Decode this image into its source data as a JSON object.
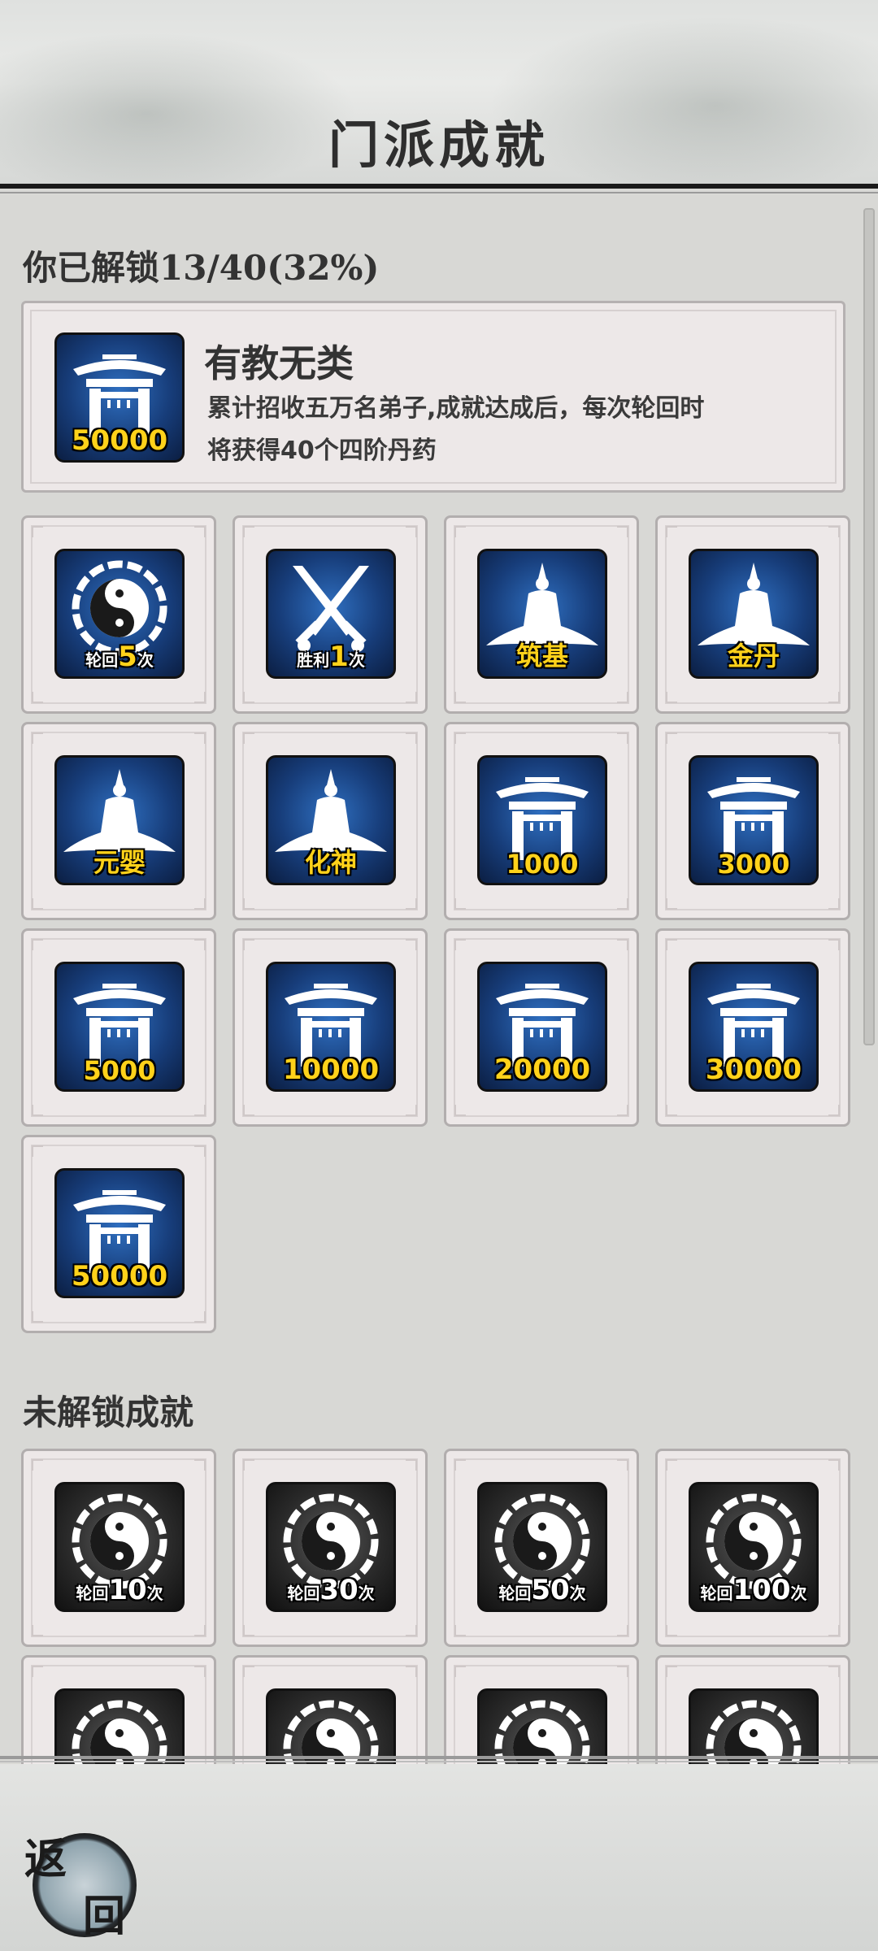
{
  "header": {
    "title": "门派成就"
  },
  "unlocked": {
    "heading": "你已解锁13/40(32%)",
    "featured": {
      "icon": "gate-icon",
      "icon_label": "50000",
      "name": "有教无类",
      "desc_line1": "累计招收五万名弟子,成就达成后，每次轮回时",
      "desc_line2": "将获得40个四阶丹药"
    },
    "tiles": [
      {
        "icon": "yin-yang-icon",
        "pre": "轮回",
        "num": "5",
        "post": "次"
      },
      {
        "icon": "crossed-swords-icon",
        "pre": "胜利",
        "num": "1",
        "post": "次"
      },
      {
        "icon": "cultivator-icon",
        "label": "筑基"
      },
      {
        "icon": "cultivator-icon",
        "label": "金丹"
      },
      {
        "icon": "cultivator-icon",
        "label": "元婴"
      },
      {
        "icon": "cultivator-icon",
        "label": "化神"
      },
      {
        "icon": "gate-icon",
        "label": "1000"
      },
      {
        "icon": "gate-icon",
        "label": "3000"
      },
      {
        "icon": "gate-icon",
        "label": "5000"
      },
      {
        "icon": "gate-icon",
        "label": "10000"
      },
      {
        "icon": "gate-icon",
        "label": "20000"
      },
      {
        "icon": "gate-icon",
        "label": "30000"
      },
      {
        "icon": "gate-icon",
        "label": "50000"
      }
    ]
  },
  "locked": {
    "heading": "未解锁成就",
    "tiles": [
      {
        "icon": "yin-yang-icon",
        "pre": "轮回",
        "num": "10",
        "post": "次"
      },
      {
        "icon": "yin-yang-icon",
        "pre": "轮回",
        "num": "30",
        "post": "次"
      },
      {
        "icon": "yin-yang-icon",
        "pre": "轮回",
        "num": "50",
        "post": "次"
      },
      {
        "icon": "yin-yang-icon",
        "pre": "轮回",
        "num": "100",
        "post": "次"
      },
      {
        "icon": "yin-yang-icon"
      },
      {
        "icon": "yin-yang-icon"
      },
      {
        "icon": "yin-yang-icon"
      },
      {
        "icon": "yin-yang-icon"
      }
    ]
  },
  "footer": {
    "back_char1": "返",
    "back_char2": "回"
  },
  "colors": {
    "badge_blue": "#173d7a",
    "badge_gold": "#ffd21a",
    "tile_bg": "#ede8e8"
  }
}
